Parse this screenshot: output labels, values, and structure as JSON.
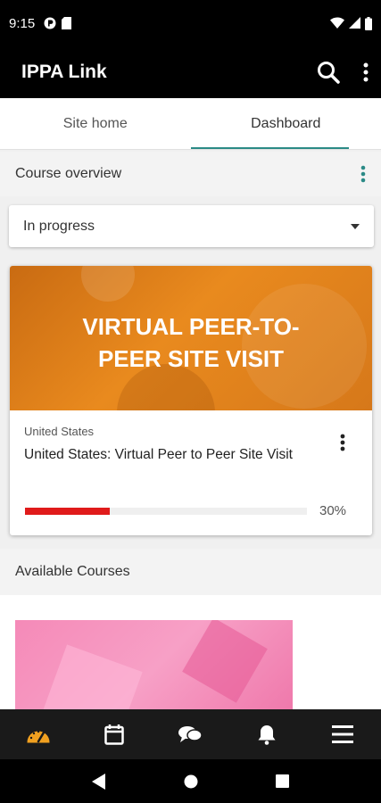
{
  "status_bar": {
    "time": "9:15"
  },
  "app_bar": {
    "title": "IPPA Link"
  },
  "tabs": [
    {
      "label": "Site home",
      "active": false
    },
    {
      "label": "Dashboard",
      "active": true
    }
  ],
  "course_overview": {
    "header": "Course overview",
    "filter": {
      "selected": "In progress"
    },
    "courses": [
      {
        "image_text": "VIRTUAL PEER-TO-PEER SITE VISIT",
        "category": "United States",
        "title": "United States: Virtual Peer to Peer Site Visit",
        "progress": 30,
        "progress_label": "30%"
      }
    ]
  },
  "available_courses": {
    "header": "Available Courses"
  },
  "bottom_nav": [
    {
      "icon": "dashboard-icon",
      "active": true
    },
    {
      "icon": "calendar-icon",
      "active": false
    },
    {
      "icon": "messages-icon",
      "active": false
    },
    {
      "icon": "notifications-icon",
      "active": false
    },
    {
      "icon": "menu-icon",
      "active": false
    }
  ],
  "colors": {
    "accent": "#2b8a86",
    "progress": "#e01b1b",
    "nav_active": "#f0a020",
    "card_banner": "#e98a1e",
    "available_thumb": "#f58ab8"
  }
}
